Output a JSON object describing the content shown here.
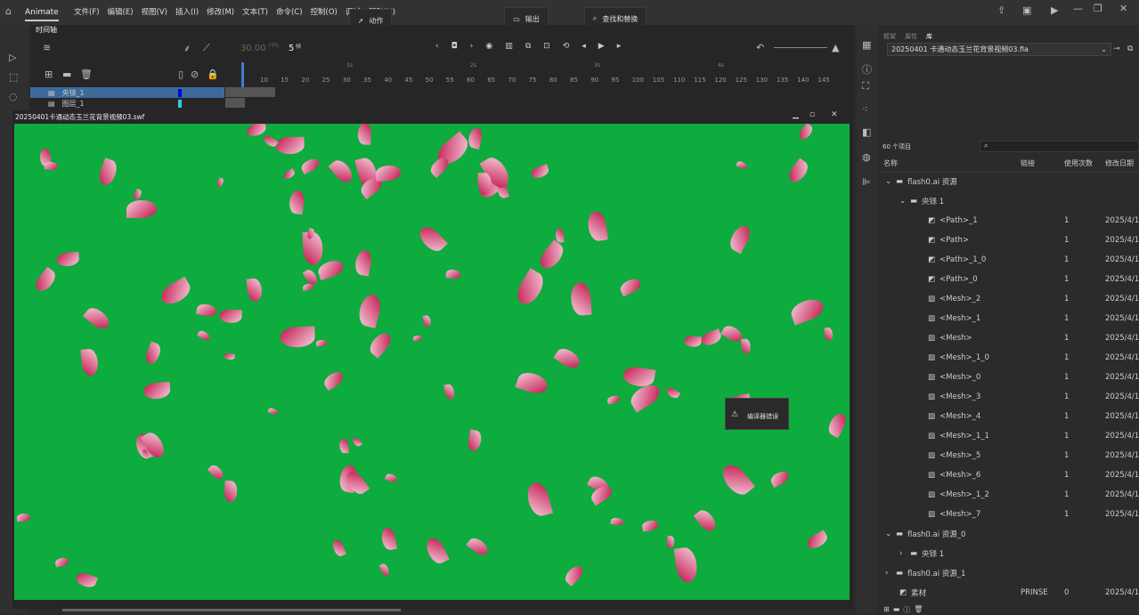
{
  "app": {
    "name": "Animate",
    "menus": [
      "文件(F)",
      "编辑(E)",
      "视图(V)",
      "插入(I)",
      "修改(M)",
      "文本(T)",
      "命令(C)",
      "控制(O)",
      "调试",
      "帮助(H)"
    ]
  },
  "panels": {
    "actions": "动作",
    "output": "输出",
    "find_replace": "查找和替换",
    "compiler_errors": "编译器错误"
  },
  "timeline": {
    "tab": "时间轴",
    "fps": "30.00",
    "fps_unit": "FPS",
    "frame": "5",
    "frame_unit": "帧",
    "seconds": [
      "1s",
      "2s",
      "3s",
      "4s"
    ],
    "ruler": [
      "10",
      "15",
      "20",
      "25",
      "30",
      "35",
      "40",
      "45",
      "50",
      "55",
      "60",
      "65",
      "70",
      "75",
      "80",
      "85",
      "90",
      "95",
      "100",
      "105",
      "110",
      "115",
      "120",
      "125",
      "130",
      "135",
      "140",
      "145"
    ],
    "layers": [
      {
        "name": "央铩_1",
        "color": "#0000dd",
        "selected": true
      },
      {
        "name": "图层_1",
        "color": "#33ccdd",
        "selected": false
      }
    ]
  },
  "document": {
    "swf_title": "20250401卡通动态玉兰花背景视频03.swf"
  },
  "library": {
    "tabs": [
      "框架",
      "属性",
      "库"
    ],
    "file": "20250401 卡通动态玉兰花背景视频03.fla",
    "count": "60 个项目",
    "columns": [
      "名称",
      "链接",
      "使用次数",
      "修改日期"
    ],
    "items": [
      {
        "name": "flash0.ai 资源",
        "level": 0,
        "type": "folder",
        "expanded": true,
        "link": "",
        "uses": "",
        "date": ""
      },
      {
        "name": "央铩 1",
        "level": 1,
        "type": "folder",
        "expanded": true,
        "link": "",
        "uses": "",
        "date": ""
      },
      {
        "name": "<Path>_1",
        "level": 2,
        "type": "graphic",
        "link": "",
        "uses": "1",
        "date": "2025/4/1"
      },
      {
        "name": "<Path>",
        "level": 2,
        "type": "graphic",
        "link": "",
        "uses": "1",
        "date": "2025/4/1"
      },
      {
        "name": "<Path>_1_0",
        "level": 2,
        "type": "graphic",
        "link": "",
        "uses": "1",
        "date": "2025/4/1"
      },
      {
        "name": "<Path>_0",
        "level": 2,
        "type": "graphic",
        "link": "",
        "uses": "1",
        "date": "2025/4/1"
      },
      {
        "name": "<Mesh>_2",
        "level": 2,
        "type": "bitmap",
        "link": "",
        "uses": "1",
        "date": "2025/4/1"
      },
      {
        "name": "<Mesh>_1",
        "level": 2,
        "type": "bitmap",
        "link": "",
        "uses": "1",
        "date": "2025/4/1"
      },
      {
        "name": "<Mesh>",
        "level": 2,
        "type": "bitmap",
        "link": "",
        "uses": "1",
        "date": "2025/4/1"
      },
      {
        "name": "<Mesh>_1_0",
        "level": 2,
        "type": "bitmap",
        "link": "",
        "uses": "1",
        "date": "2025/4/1"
      },
      {
        "name": "<Mesh>_0",
        "level": 2,
        "type": "bitmap",
        "link": "",
        "uses": "1",
        "date": "2025/4/1"
      },
      {
        "name": "<Mesh>_3",
        "level": 2,
        "type": "bitmap",
        "link": "",
        "uses": "1",
        "date": "2025/4/1"
      },
      {
        "name": "<Mesh>_4",
        "level": 2,
        "type": "bitmap",
        "link": "",
        "uses": "1",
        "date": "2025/4/1"
      },
      {
        "name": "<Mesh>_1_1",
        "level": 2,
        "type": "bitmap",
        "link": "",
        "uses": "1",
        "date": "2025/4/1"
      },
      {
        "name": "<Mesh>_5",
        "level": 2,
        "type": "bitmap",
        "link": "",
        "uses": "1",
        "date": "2025/4/1"
      },
      {
        "name": "<Mesh>_6",
        "level": 2,
        "type": "bitmap",
        "link": "",
        "uses": "1",
        "date": "2025/4/1"
      },
      {
        "name": "<Mesh>_1_2",
        "level": 2,
        "type": "bitmap",
        "link": "",
        "uses": "1",
        "date": "2025/4/1"
      },
      {
        "name": "<Mesh>_7",
        "level": 2,
        "type": "bitmap",
        "link": "",
        "uses": "1",
        "date": "2025/4/1"
      },
      {
        "name": "flash0.ai 资源_0",
        "level": 0,
        "type": "folder",
        "expanded": true,
        "link": "",
        "uses": "",
        "date": ""
      },
      {
        "name": "央铩 1",
        "level": 1,
        "type": "folder",
        "expanded": false,
        "link": "",
        "uses": "",
        "date": ""
      },
      {
        "name": "flash0.ai 资源_1",
        "level": 0,
        "type": "folder",
        "expanded": false,
        "link": "",
        "uses": "",
        "date": ""
      },
      {
        "name": "素材",
        "level": 0,
        "type": "graphic",
        "link": "PRINSE",
        "uses": "0",
        "date": "2025/4/1"
      }
    ]
  },
  "colors": {
    "stage": "#0eab3e",
    "selected_layer": "#3d6a99"
  }
}
